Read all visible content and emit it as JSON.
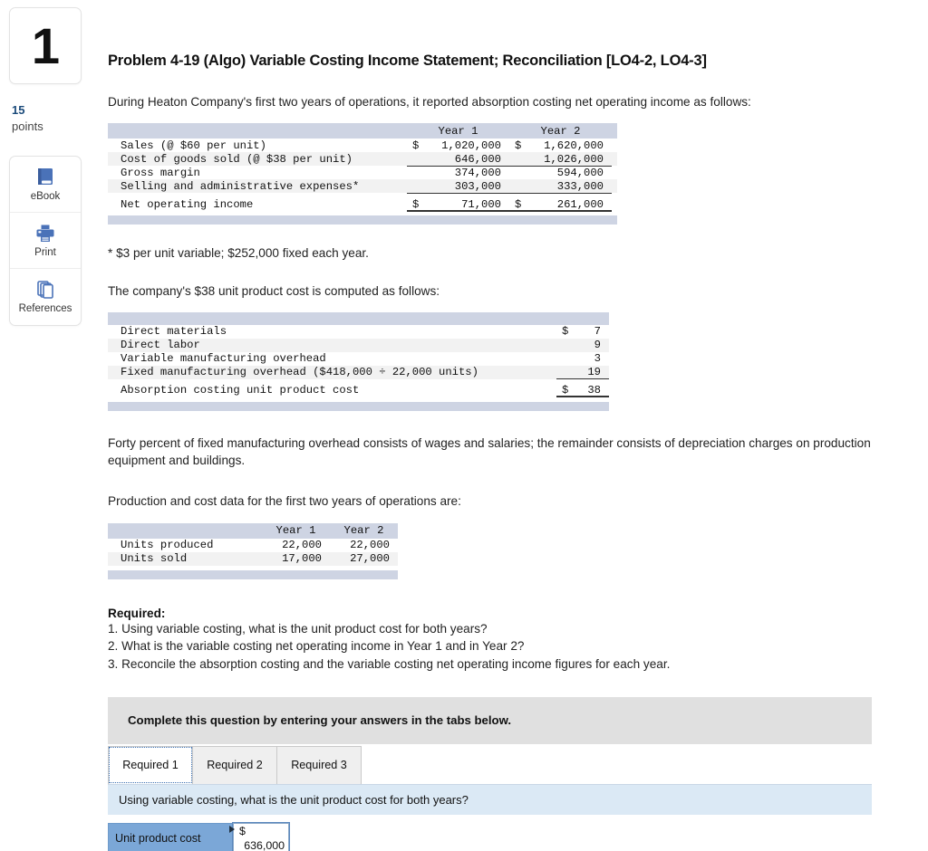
{
  "rail": {
    "question_number": "1",
    "points_value": "15",
    "points_label": "points",
    "tools": [
      {
        "label": "eBook",
        "icon": "ebook-icon"
      },
      {
        "label": "Print",
        "icon": "print-icon"
      },
      {
        "label": "References",
        "icon": "references-icon"
      }
    ]
  },
  "problem": {
    "title": "Problem 4-19 (Algo) Variable Costing Income Statement; Reconciliation [LO4-2, LO4-3]",
    "intro": "During Heaton Company's first two years of operations, it reported absorption costing net operating income as follows:",
    "footnote": "* $3 per unit variable; $252,000 fixed each year.",
    "cost_intro": "The company's $38 unit product cost is computed as follows:",
    "overhead_note": "Forty percent of fixed manufacturing overhead consists of wages and salaries; the remainder consists of depreciation charges on production equipment and buildings.",
    "production_intro": "Production and cost data for the first two years of operations are:"
  },
  "income_statement": {
    "columns": [
      "Year 1",
      "Year 2"
    ],
    "rows": [
      {
        "label": "Sales (@ $60 per unit)",
        "year1_sym": "$",
        "year1": "1,020,000",
        "year2_sym": "$",
        "year2": "1,620,000",
        "rule": "none"
      },
      {
        "label": "Cost of goods sold (@ $38 per unit)",
        "year1_sym": "",
        "year1": "646,000",
        "year2_sym": "",
        "year2": "1,026,000",
        "rule": "single"
      },
      {
        "label": "Gross margin",
        "year1_sym": "",
        "year1": "374,000",
        "year2_sym": "",
        "year2": "594,000",
        "rule": "none"
      },
      {
        "label": "Selling and administrative expenses*",
        "year1_sym": "",
        "year1": "303,000",
        "year2_sym": "",
        "year2": "333,000",
        "rule": "single"
      },
      {
        "label": "Net operating income",
        "year1_sym": "$",
        "year1": "71,000",
        "year2_sym": "$",
        "year2": "261,000",
        "rule": "double"
      }
    ]
  },
  "unit_cost_table": {
    "rows": [
      {
        "label": "Direct materials",
        "sym": "$",
        "value": "7",
        "rule": "none"
      },
      {
        "label": "Direct labor",
        "sym": "",
        "value": "9",
        "rule": "none"
      },
      {
        "label": "Variable manufacturing overhead",
        "sym": "",
        "value": "3",
        "rule": "none"
      },
      {
        "label": "Fixed manufacturing overhead ($418,000 ÷ 22,000 units)",
        "sym": "",
        "value": "19",
        "rule": "single"
      },
      {
        "label": "Absorption costing unit product cost",
        "sym": "$",
        "value": "38",
        "rule": "double"
      }
    ]
  },
  "production_table": {
    "columns": [
      "Year 1",
      "Year 2"
    ],
    "rows": [
      {
        "label": "Units produced",
        "year1": "22,000",
        "year2": "22,000"
      },
      {
        "label": "Units sold",
        "year1": "17,000",
        "year2": "27,000"
      }
    ]
  },
  "required": {
    "heading": "Required:",
    "items": [
      "1. Using variable costing, what is the unit product cost for both years?",
      "2. What is the variable costing net operating income in Year 1 and in Year 2?",
      "3. Reconcile the absorption costing and the variable costing net operating income figures for each year."
    ]
  },
  "answer_widget": {
    "banner": "Complete this question by entering your answers in the tabs below.",
    "tabs": [
      {
        "label": "Required 1",
        "active": true
      },
      {
        "label": "Required 2",
        "active": false
      },
      {
        "label": "Required 3",
        "active": false
      }
    ],
    "question": "Using variable costing, what is the unit product cost for both years?",
    "row_label": "Unit product cost",
    "input_symbol": "$",
    "input_value": "636,000"
  },
  "colors": {
    "table_band": "#ced4e3",
    "banner_bg": "#e0e0e0",
    "question_bar_bg": "#dbe9f5",
    "answer_label_bg": "#7ba7d7",
    "accent": "#4a72b8",
    "points_color": "#1a4a7a"
  }
}
